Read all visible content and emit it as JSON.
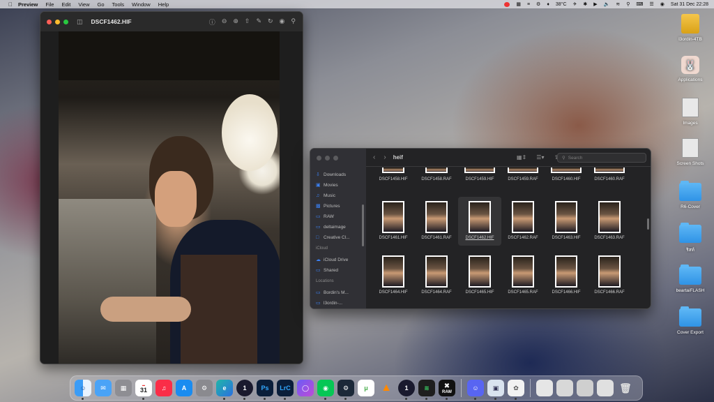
{
  "menubar": {
    "apple_icon": "apple-icon",
    "app_name": "Preview",
    "menus": [
      "File",
      "Edit",
      "View",
      "Go",
      "Tools",
      "Window",
      "Help"
    ],
    "temperature": "38°C",
    "clock": "Sat 31 Dec  22:28"
  },
  "preview": {
    "title": "DSCF1462.HIF"
  },
  "finder": {
    "folder": "heif",
    "search_placeholder": "Search",
    "sidebar": {
      "favorites": [
        "Downloads",
        "Movies",
        "Music",
        "Pictures",
        "RAW",
        "deltaimage",
        "Creative Cl..."
      ],
      "icloud_header": "iCloud",
      "icloud": [
        "iCloud Drive",
        "Shared"
      ],
      "locations_header": "Locations",
      "locations": [
        "Bordin's M...",
        "l3ordin-..."
      ]
    },
    "top_row": [
      "DSCF1458.HIF",
      "DSCF1458.RAF",
      "DSCF1459.HIF",
      "DSCF1459.RAF",
      "DSCF1460.HIF",
      "DSCF1460.RAF"
    ],
    "row2": [
      "DSCF1461.HIF",
      "DSCF1461.RAF",
      "DSCF1462.HIF",
      "DSCF1462.RAF",
      "DSCF1463.HIF",
      "DSCF1463.RAF"
    ],
    "row3": [
      "DSCF1464.HIF",
      "DSCF1464.RAF",
      "DSCF1465.HIF",
      "DSCF1465.RAF",
      "DSCF1466.HIF",
      "DSCF1466.RAF"
    ],
    "selected": "DSCF1462.HIF"
  },
  "desktop": {
    "icons": [
      "l3ordin-4TB",
      "Applications",
      "Images",
      "Screen Shots",
      "R6-Cover",
      "ริสท์",
      "beartaiFLASH",
      "Cover Export"
    ]
  },
  "dock": {
    "calendar_day": "31",
    "apps": [
      "Finder",
      "Mail",
      "Launchpad",
      "Calendar",
      "Music",
      "App Store",
      "System Settings",
      "Edge",
      "1Password",
      "Photoshop",
      "Lightroom Classic",
      "Arc",
      "LINE",
      "Steam",
      "uTorrent",
      "VLC",
      "1Password 7",
      "Activity Monitor",
      "RAW Converter",
      "Discord",
      "Preview",
      "Photos"
    ],
    "ps_label": "Ps",
    "lrc_label": "LrC",
    "raw_label": "RAW"
  },
  "colors": {
    "accent": "#3b82f6",
    "traffic_red": "#ff5f57",
    "traffic_yellow": "#febc2e",
    "traffic_green": "#28c840",
    "folder_blue": "#2f93e6"
  }
}
